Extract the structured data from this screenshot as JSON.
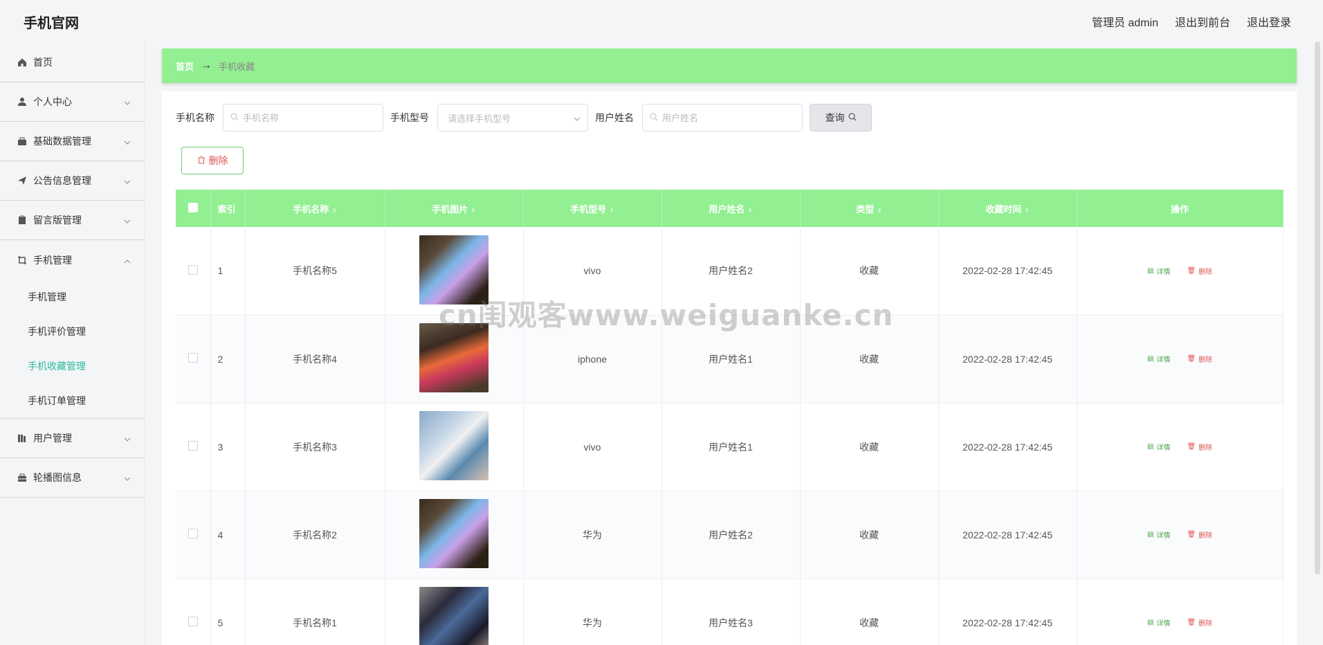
{
  "brand": "手机官网",
  "top": {
    "admin": "管理员 admin",
    "to_front": "退出到前台",
    "logout": "退出登录"
  },
  "sidebar": {
    "items": [
      {
        "label": "首页"
      },
      {
        "label": "个人中心"
      },
      {
        "label": "基础数据管理"
      },
      {
        "label": "公告信息管理"
      },
      {
        "label": "留言版管理"
      },
      {
        "label": "手机管理"
      }
    ],
    "sub_items": [
      {
        "label": "手机管理"
      },
      {
        "label": "手机评价管理"
      },
      {
        "label": "手机收藏管理"
      },
      {
        "label": "手机订单管理"
      }
    ],
    "items_after": [
      {
        "label": "用户管理"
      },
      {
        "label": "轮播图信息"
      }
    ]
  },
  "breadcrumb": {
    "home": "首页",
    "sep": "→",
    "current": "手机收藏"
  },
  "search": {
    "name_label": "手机名称",
    "name_placeholder": "手机名称",
    "model_label": "手机型号",
    "model_placeholder": "请选择手机型号",
    "user_label": "用户姓名",
    "user_placeholder": "用户姓名",
    "query_label": "查询"
  },
  "delete_label": "删除",
  "table": {
    "headers": [
      "索引",
      "手机名称",
      "手机图片",
      "手机型号",
      "用户姓名",
      "类型",
      "收藏时间",
      "操作"
    ],
    "rows": [
      {
        "index": "1",
        "name": "手机名称5",
        "model": "vivo",
        "user": "用户姓名2",
        "type": "收藏",
        "time": "2022-02-28 17:42:45"
      },
      {
        "index": "2",
        "name": "手机名称4",
        "model": "iphone",
        "user": "用户姓名1",
        "type": "收藏",
        "time": "2022-02-28 17:42:45"
      },
      {
        "index": "3",
        "name": "手机名称3",
        "model": "vivo",
        "user": "用户姓名1",
        "type": "收藏",
        "time": "2022-02-28 17:42:45"
      },
      {
        "index": "4",
        "name": "手机名称2",
        "model": "华为",
        "user": "用户姓名2",
        "type": "收藏",
        "time": "2022-02-28 17:42:45"
      },
      {
        "index": "5",
        "name": "手机名称1",
        "model": "华为",
        "user": "用户姓名3",
        "type": "收藏",
        "time": "2022-02-28 17:42:45"
      }
    ],
    "op_detail": "详情",
    "op_delete": "删除"
  },
  "watermark": "cn闺观客www.weiguanke.cn",
  "colors": {
    "accent": "#92ef92",
    "active_menu": "#2dbb9e",
    "danger": "#e05555"
  }
}
